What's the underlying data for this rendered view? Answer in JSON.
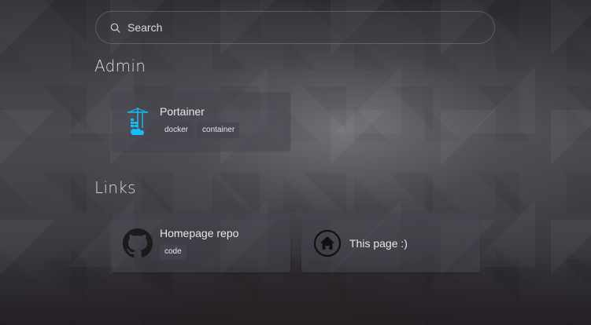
{
  "search": {
    "placeholder": "Search",
    "icon": "search-icon"
  },
  "groups": [
    {
      "title": "Admin",
      "items": [
        {
          "name": "Portainer",
          "icon": "portainer-icon",
          "icon_color": "#13bef9",
          "tags": [
            "docker",
            "container"
          ]
        }
      ]
    },
    {
      "title": "Links",
      "items": [
        {
          "name": "Homepage repo",
          "icon": "github-icon",
          "tags": [
            "code"
          ]
        },
        {
          "name": "This page :)",
          "icon": "home-icon",
          "tags": []
        }
      ]
    }
  ]
}
